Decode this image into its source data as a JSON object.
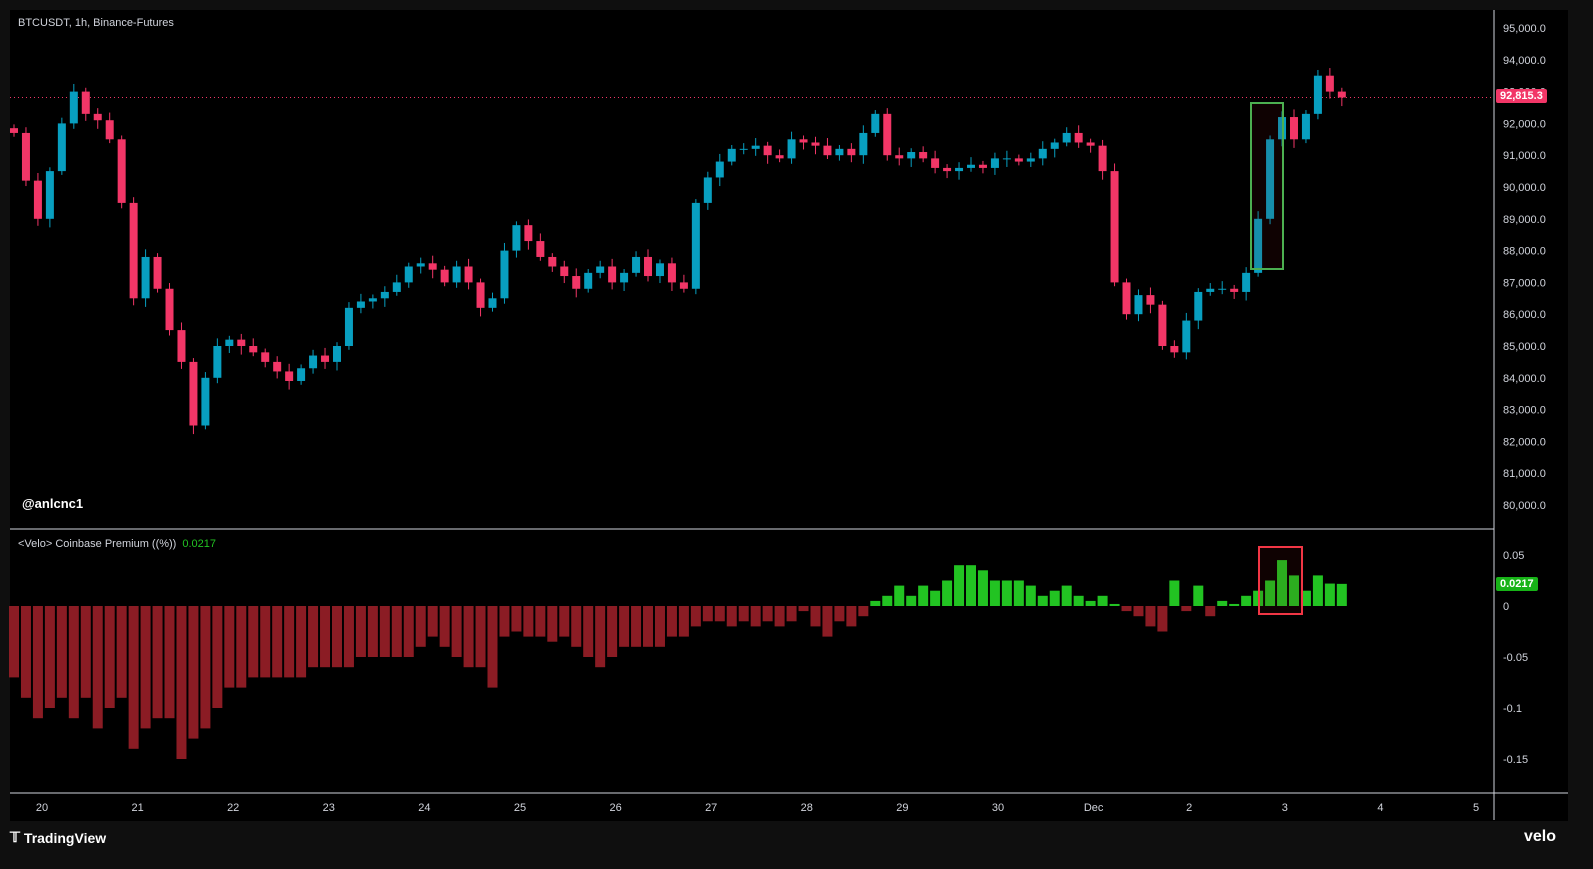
{
  "header": {
    "title": "BTCUSDT, 1h, Binance-Futures",
    "watermark": "@anlcnc1"
  },
  "indicator": {
    "title": "<Velo> Coinbase Premium ((%))",
    "value": "0.0217"
  },
  "footer": {
    "brand": "TradingView",
    "logo_text": "velo"
  },
  "colors": {
    "up": "#089fc0",
    "down": "#f23667",
    "prem_pos": "#22c322",
    "prem_neg": "#8b1c24",
    "highlight_green": "#4caf50",
    "highlight_red": "#f23645"
  },
  "chart_data": [
    {
      "type": "candlestick",
      "title": "BTCUSDT, 1h, Binance-Futures",
      "x_start": "Nov 19 16:00",
      "x_step_hours": 3,
      "ylim": [
        79500,
        95500
      ],
      "y_ticks": [
        "95,000.0",
        "94,000.0",
        "93,000.0",
        "92,000.0",
        "91,000.0",
        "90,000.0",
        "89,000.0",
        "88,000.0",
        "87,000.0",
        "86,000.0",
        "85,000.0",
        "84,000.0",
        "83,000.0",
        "82,000.0",
        "81,000.0",
        "80,000.0"
      ],
      "y_tick_values": [
        95000,
        94000,
        93000,
        92000,
        91000,
        90000,
        89000,
        88000,
        87000,
        86000,
        85000,
        84000,
        83000,
        82000,
        81000,
        80000
      ],
      "last_price": 92815.3,
      "last_price_label": "92,815.3",
      "closes": [
        91700,
        90200,
        89000,
        90500,
        92000,
        93000,
        92300,
        92100,
        91500,
        89500,
        86500,
        87800,
        86800,
        85500,
        84500,
        82500,
        84000,
        85000,
        85200,
        85000,
        84800,
        84500,
        84200,
        83900,
        84300,
        84700,
        84500,
        85000,
        86200,
        86400,
        86500,
        86700,
        87000,
        87500,
        87600,
        87400,
        87000,
        87500,
        87000,
        86200,
        86500,
        88000,
        88800,
        88300,
        87800,
        87500,
        87200,
        86800,
        87300,
        87500,
        87000,
        87300,
        87800,
        87200,
        87600,
        87000,
        86800,
        89500,
        90300,
        90800,
        91200,
        91200,
        91300,
        91000,
        90900,
        91500,
        91400,
        91300,
        91000,
        91200,
        91000,
        91700,
        92300,
        91000,
        90900,
        91100,
        90900,
        90600,
        90500,
        90600,
        90700,
        90600,
        90900,
        90900,
        90800,
        90900,
        91200,
        91400,
        91700,
        91400,
        91300,
        90500,
        87000,
        86000,
        86600,
        86300,
        85000,
        84800,
        85800,
        86700,
        86800,
        86800,
        86700,
        87300,
        89000,
        91500,
        92200,
        91500,
        92300,
        93500,
        93000,
        92815
      ]
    },
    {
      "type": "bar",
      "title": "<Velo> Coinbase Premium ((%))",
      "x_start": "Nov 19 16:00",
      "x_step_hours": 3,
      "ylim": [
        -0.18,
        0.075
      ],
      "y_ticks": [
        "0.05",
        "0",
        "-0.05",
        "-0.1",
        "-0.15"
      ],
      "y_tick_values": [
        0.05,
        0,
        -0.05,
        -0.1,
        -0.15
      ],
      "last_value": 0.0217,
      "values": [
        -0.07,
        -0.09,
        -0.11,
        -0.1,
        -0.09,
        -0.11,
        -0.09,
        -0.12,
        -0.1,
        -0.09,
        -0.14,
        -0.12,
        -0.11,
        -0.11,
        -0.15,
        -0.13,
        -0.12,
        -0.1,
        -0.08,
        -0.08,
        -0.07,
        -0.07,
        -0.07,
        -0.07,
        -0.07,
        -0.06,
        -0.06,
        -0.06,
        -0.06,
        -0.05,
        -0.05,
        -0.05,
        -0.05,
        -0.05,
        -0.04,
        -0.03,
        -0.04,
        -0.05,
        -0.06,
        -0.06,
        -0.08,
        -0.03,
        -0.025,
        -0.03,
        -0.03,
        -0.035,
        -0.03,
        -0.04,
        -0.05,
        -0.06,
        -0.05,
        -0.04,
        -0.04,
        -0.04,
        -0.04,
        -0.03,
        -0.03,
        -0.02,
        -0.015,
        -0.015,
        -0.02,
        -0.015,
        -0.02,
        -0.015,
        -0.02,
        -0.015,
        -0.005,
        -0.02,
        -0.03,
        -0.015,
        -0.02,
        -0.01,
        0.005,
        0.01,
        0.02,
        0.01,
        0.02,
        0.015,
        0.025,
        0.04,
        0.04,
        0.035,
        0.025,
        0.025,
        0.025,
        0.02,
        0.01,
        0.015,
        0.02,
        0.01,
        0.005,
        0.01,
        0.002,
        -0.005,
        -0.01,
        -0.02,
        -0.025,
        0.025,
        -0.005,
        0.02,
        -0.01,
        0.005,
        0.002,
        0.01,
        0.015,
        0.025,
        0.045,
        0.03,
        0.015,
        0.03,
        0.022,
        0.0217
      ]
    }
  ],
  "x_axis": {
    "ticks": [
      "20",
      "21",
      "22",
      "23",
      "24",
      "25",
      "26",
      "27",
      "28",
      "29",
      "30",
      "Dec",
      "2",
      "3",
      "4",
      "5"
    ]
  }
}
